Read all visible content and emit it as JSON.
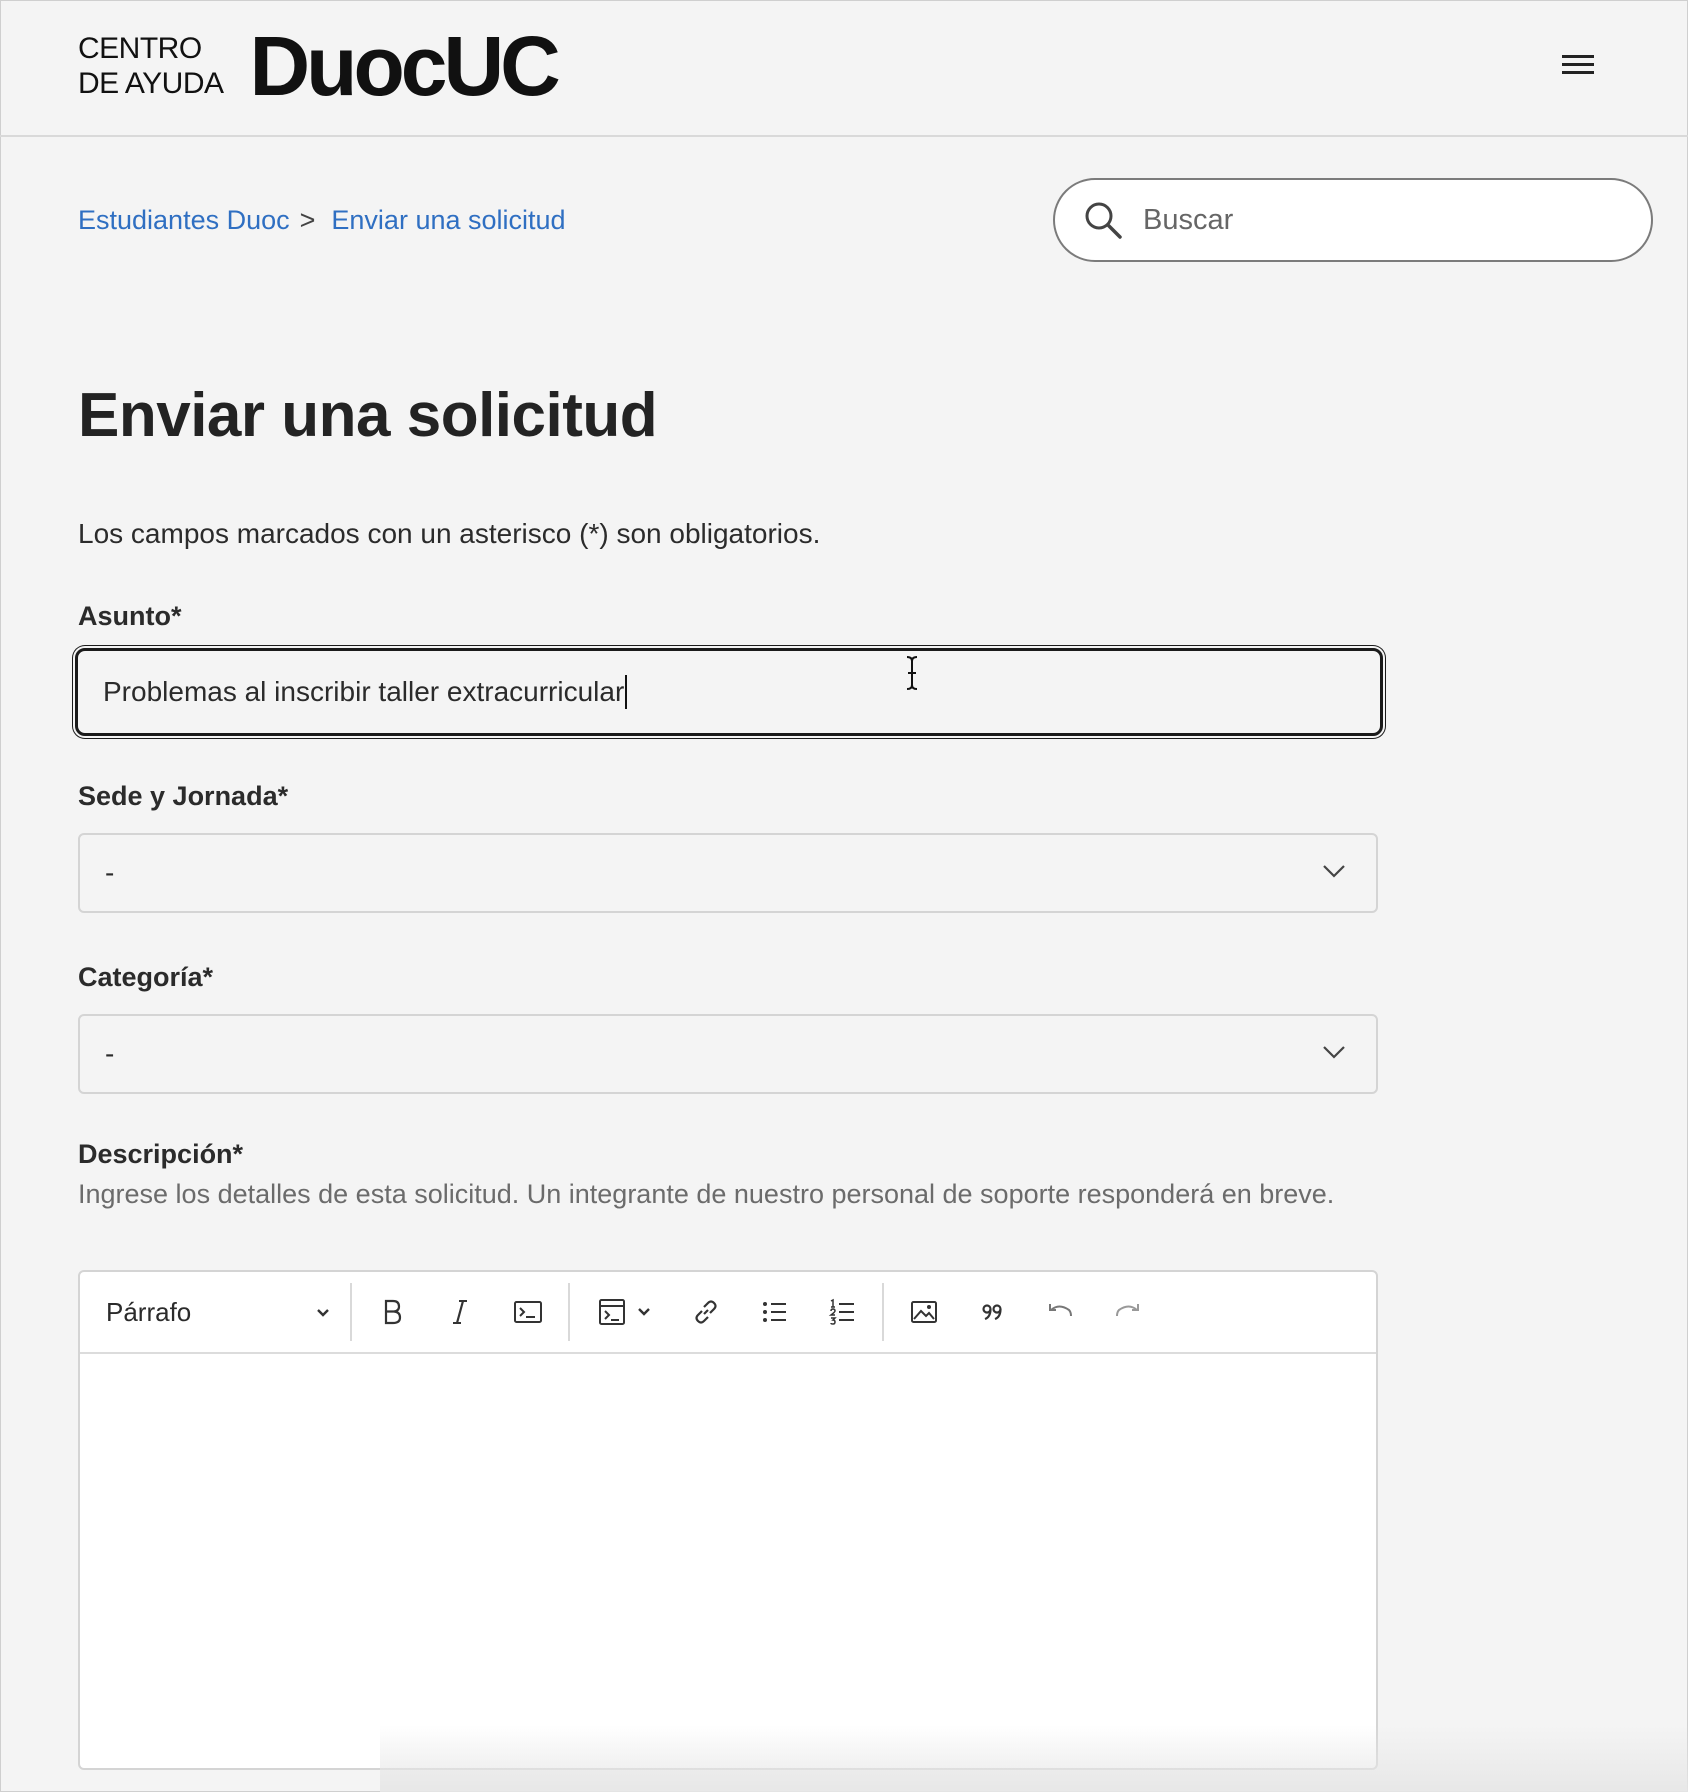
{
  "header": {
    "logo_line1": "CENTRO",
    "logo_line2": "DE AYUDA",
    "logo_brand": "DuocUC"
  },
  "breadcrumb": {
    "items": [
      {
        "label": "Estudiantes Duoc"
      },
      {
        "label": "Enviar una solicitud"
      }
    ],
    "separator": ">"
  },
  "search": {
    "placeholder": "Buscar",
    "value": ""
  },
  "page": {
    "title": "Enviar una solicitud",
    "required_note": "Los campos marcados con un asterisco (*) son obligatorios."
  },
  "form": {
    "subject": {
      "label": "Asunto*",
      "value": "Problemas al inscribir taller extracurricular"
    },
    "campus": {
      "label": "Sede y Jornada*",
      "selected": "-"
    },
    "category": {
      "label": "Categoría*",
      "selected": "-"
    },
    "description": {
      "label": "Descripción*",
      "hint": "Ingrese los detalles de esta solicitud. Un integrante de nuestro personal de soporte responderá en breve.",
      "value": ""
    }
  },
  "editor": {
    "paragraph_style": "Párrafo",
    "toolbar_icons": [
      "bold-icon",
      "italic-icon",
      "code-icon",
      "code-block-icon",
      "link-icon",
      "bulleted-list-icon",
      "numbered-list-icon",
      "image-icon",
      "blockquote-icon",
      "undo-icon",
      "redo-icon"
    ]
  },
  "colors": {
    "link": "#2f6fc2",
    "background": "#f4f4f4",
    "text": "#2b2b2b",
    "hint": "#6b6b6b",
    "focus_border": "#1b1b1b"
  }
}
